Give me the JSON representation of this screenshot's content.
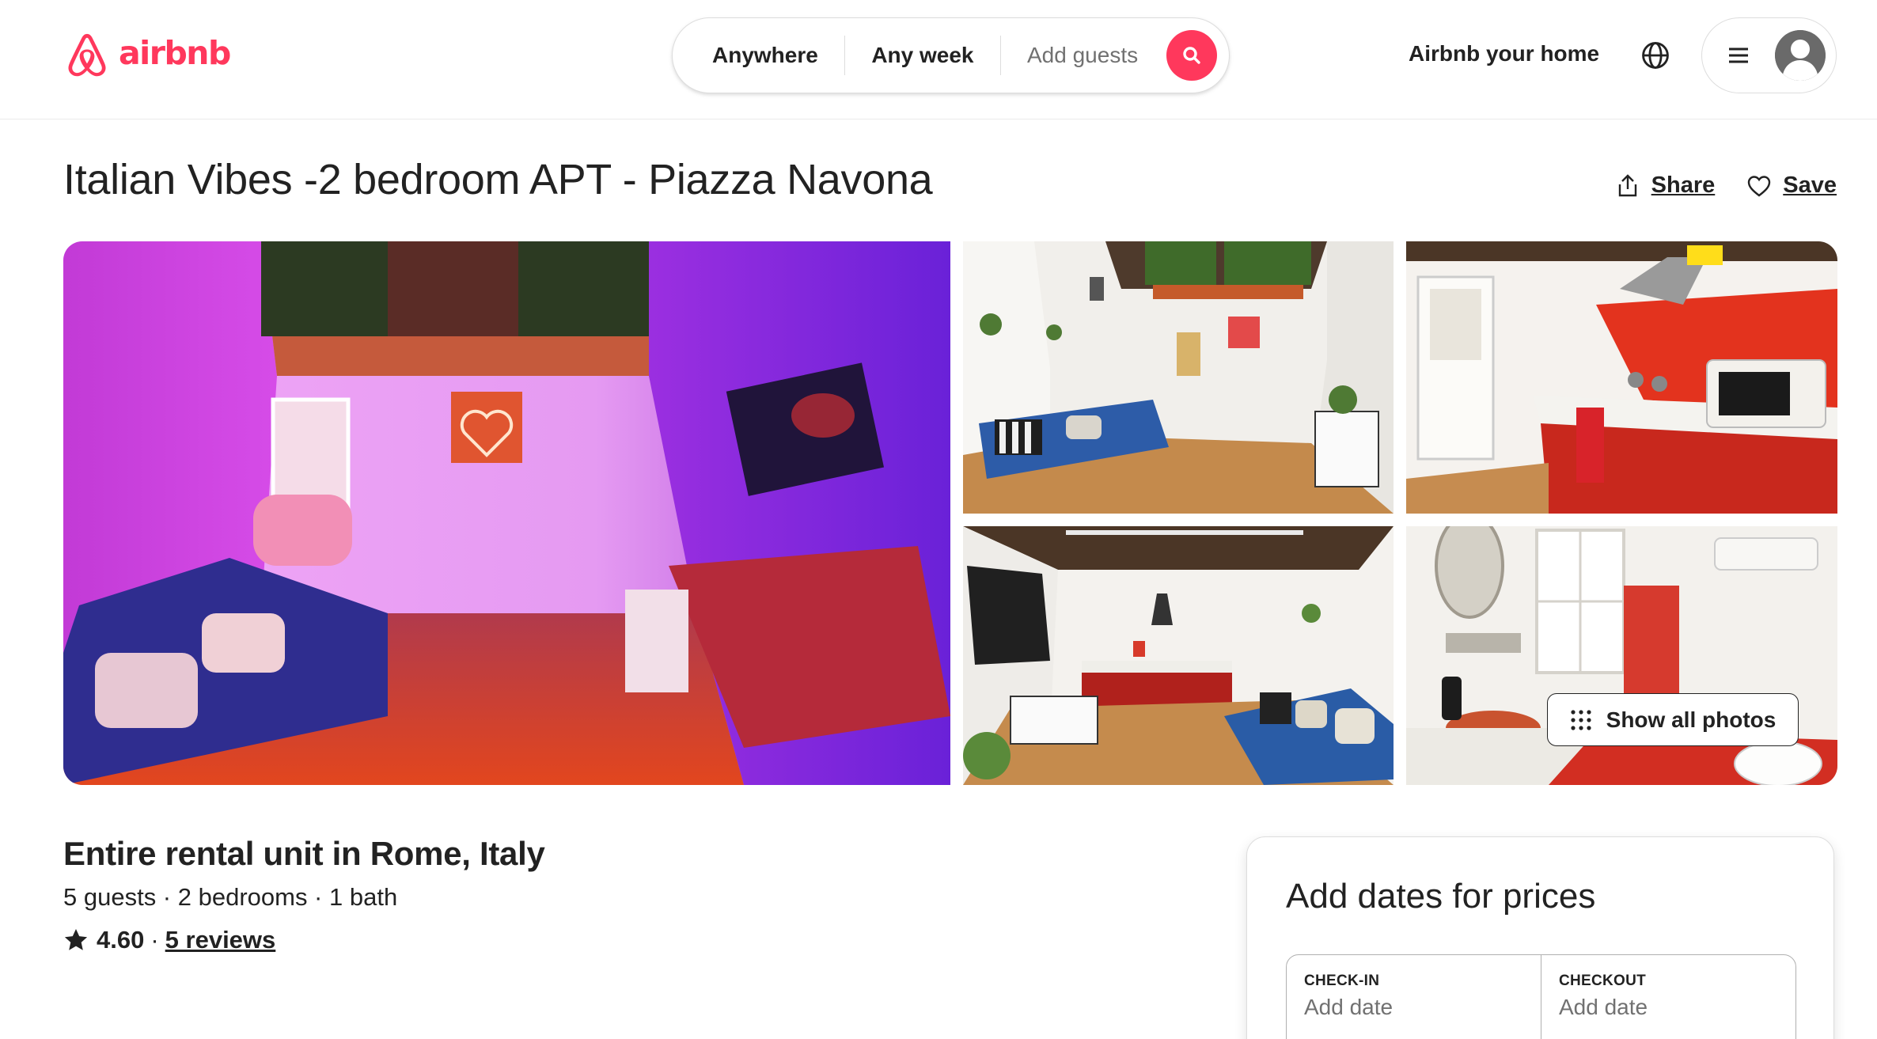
{
  "brand": {
    "name": "airbnb",
    "color": "#ff385c",
    "logo_icon": "airbnb-belo-logo"
  },
  "search": {
    "location": "Anywhere",
    "dates": "Any week",
    "guests_placeholder": "Add guests",
    "button_icon": "search-icon"
  },
  "header": {
    "host_link": "Airbnb your home",
    "language_icon": "globe-icon",
    "menu_icon": "hamburger-menu-icon",
    "avatar_icon": "user-avatar-icon"
  },
  "listing": {
    "title": "Italian Vibes -2 bedroom APT - Piazza Navona",
    "share_label": "Share",
    "save_label": "Save",
    "subtitle": "Entire rental unit in Rome, Italy",
    "facts": "5 guests · 2 bedrooms · 1 bath",
    "rating": "4.60",
    "rating_separator": "·",
    "reviews_link": "5 reviews"
  },
  "gallery": {
    "photos": [
      {
        "description": "living room with neon heart and purple lighting"
      },
      {
        "description": "living room with blue sofa and plants"
      },
      {
        "description": "kitchen with red cabinets"
      },
      {
        "description": "living room and kitchen view"
      },
      {
        "description": "bathroom with red tiled shower"
      }
    ],
    "show_all_label": "Show all photos"
  },
  "booking": {
    "title": "Add dates for prices",
    "checkin_label": "CHECK-IN",
    "checkin_value": "Add date",
    "checkout_label": "CHECKOUT",
    "checkout_value": "Add date"
  }
}
